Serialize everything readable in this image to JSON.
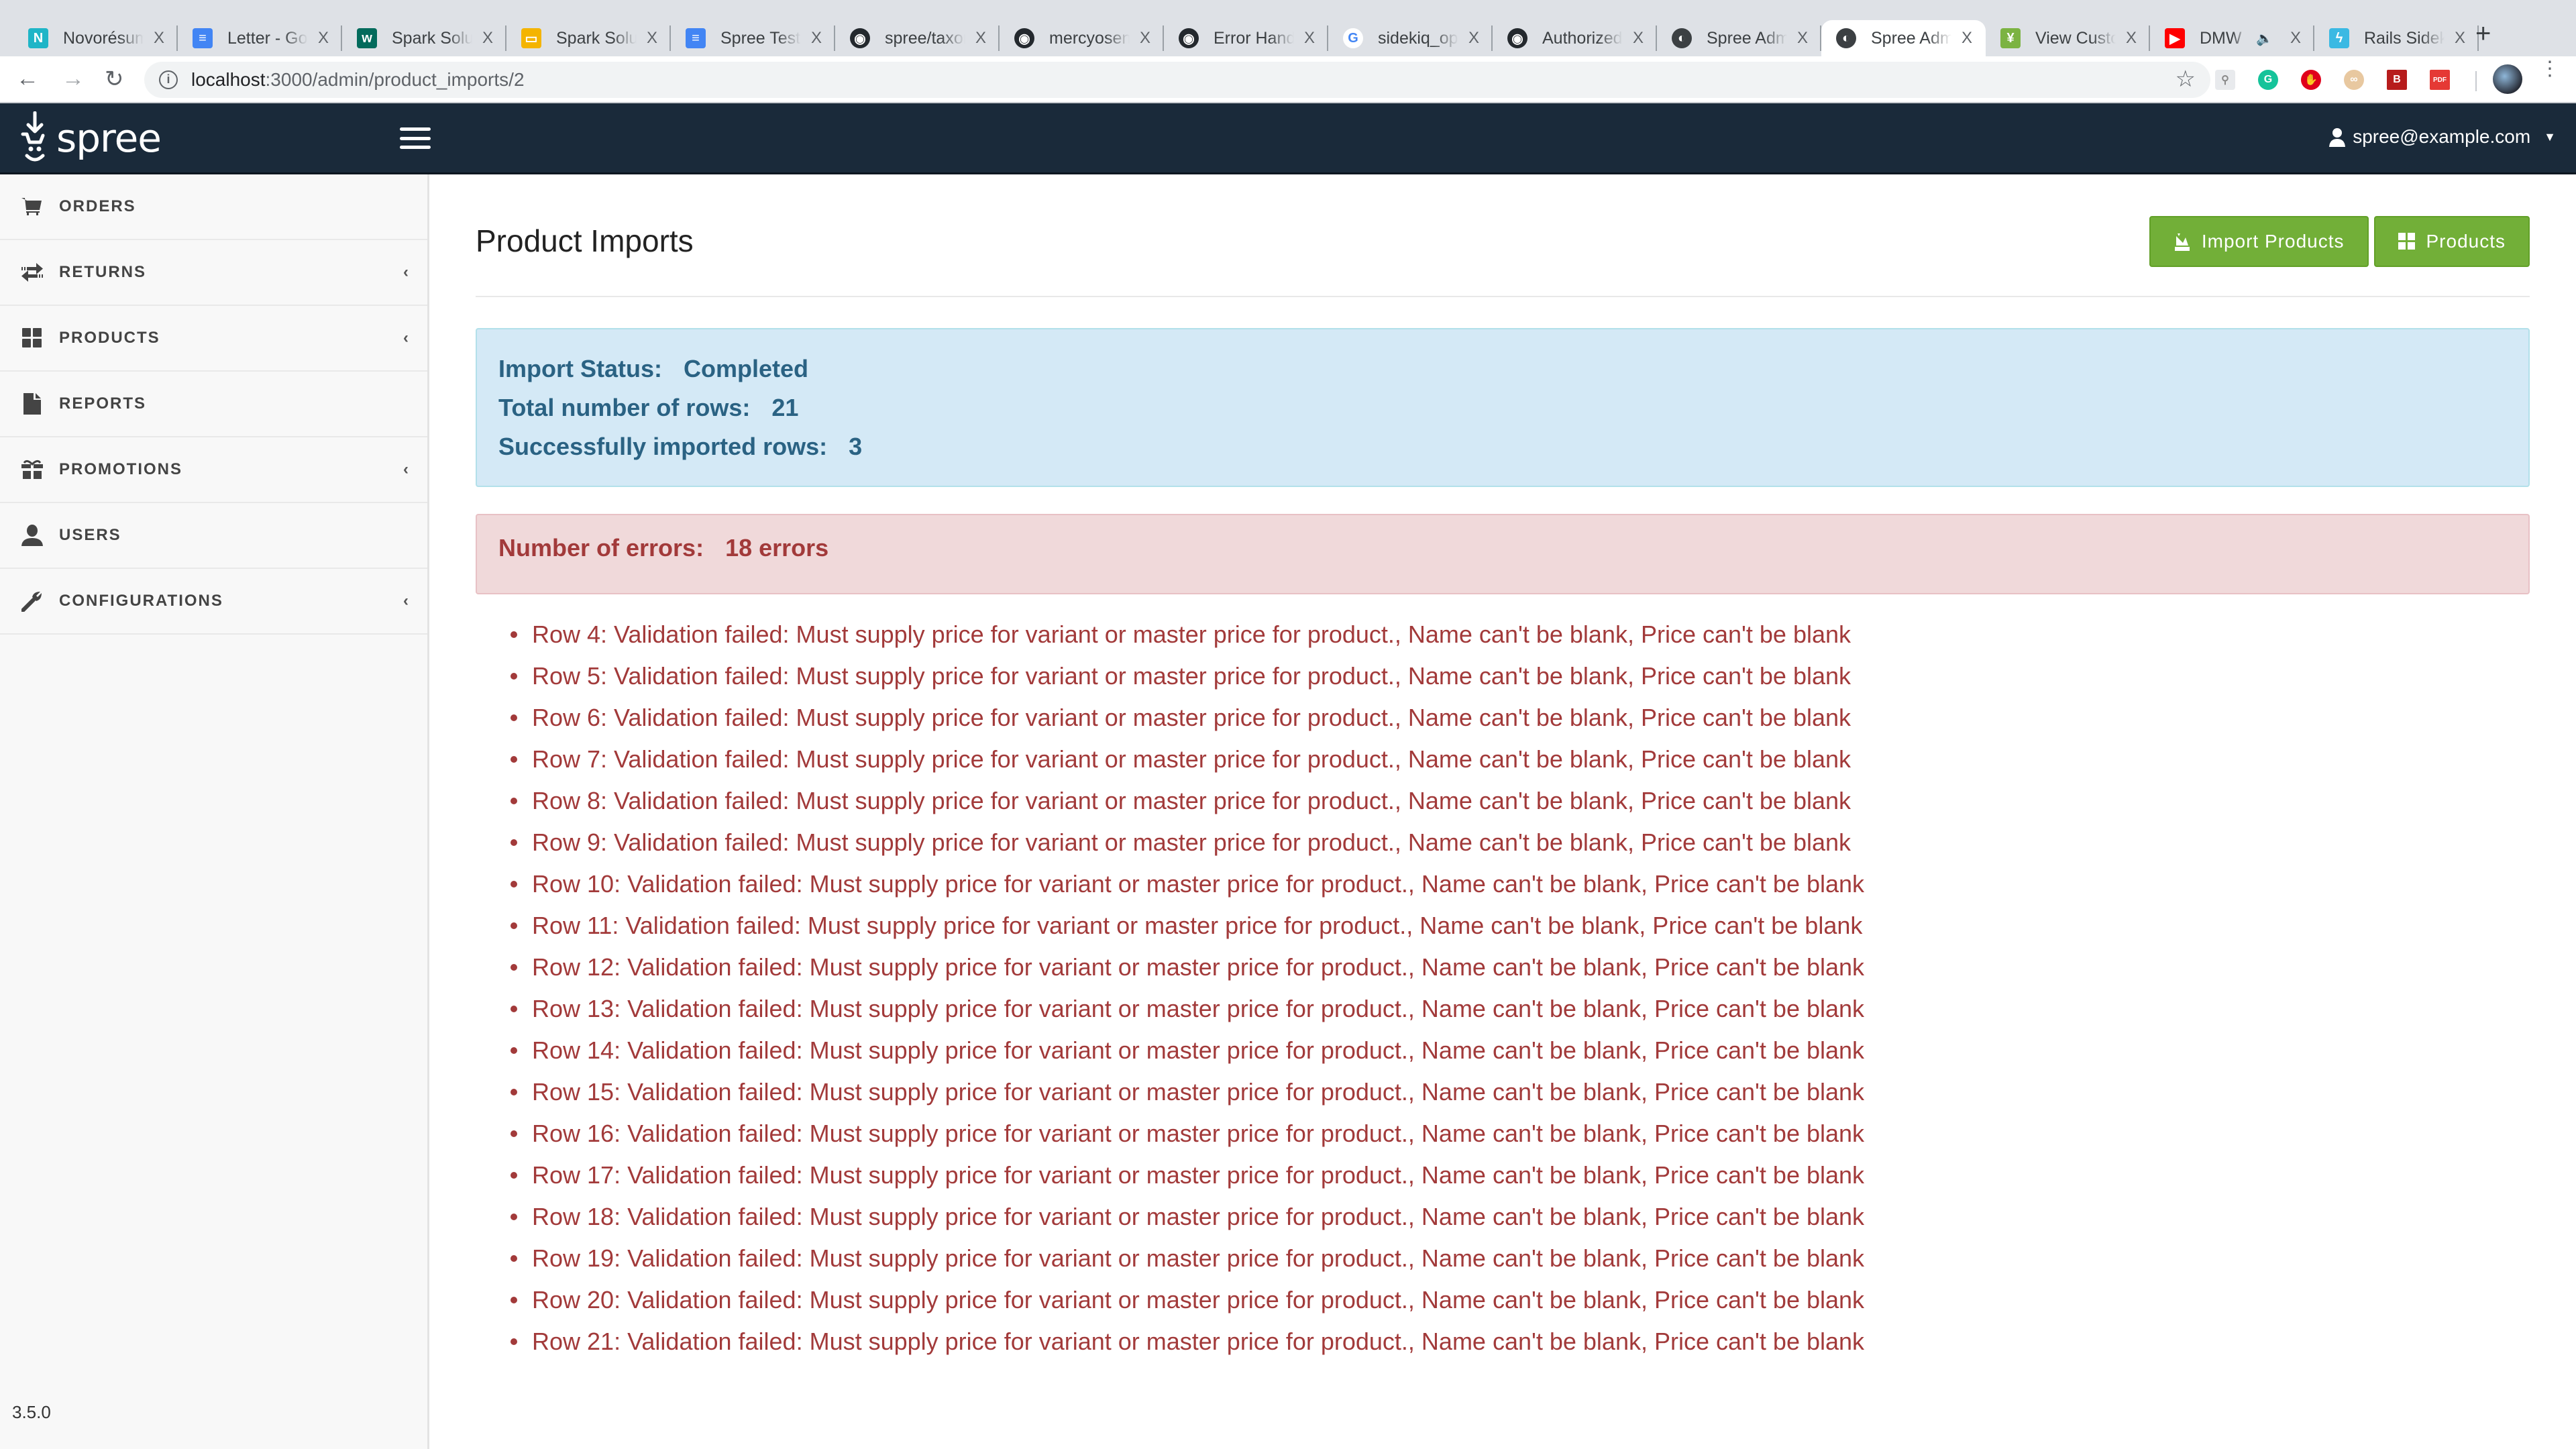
{
  "browser": {
    "tabs": [
      {
        "title": "Novorésumé",
        "icon": "novoresume-icon",
        "color": "#1fb5c7",
        "glyph": "N"
      },
      {
        "title": "Letter - Google Docs",
        "icon": "google-docs-icon",
        "color": "#4285f4",
        "glyph": "≡"
      },
      {
        "title": "Spark Solutions",
        "icon": "workable-icon",
        "color": "#036b5c",
        "glyph": "w"
      },
      {
        "title": "Spark Solutions",
        "icon": "google-slides-icon",
        "color": "#f4b400",
        "glyph": "▭"
      },
      {
        "title": "Spree Test",
        "icon": "google-docs-icon",
        "color": "#4285f4",
        "glyph": "≡"
      },
      {
        "title": "spree/taxons",
        "icon": "github-icon",
        "color": "#24292e",
        "glyph": "◉"
      },
      {
        "title": "mercyoseni",
        "icon": "github-icon",
        "color": "#24292e",
        "glyph": "◉"
      },
      {
        "title": "Error Handling",
        "icon": "github-icon",
        "color": "#24292e",
        "glyph": "◉"
      },
      {
        "title": "sidekiq_options",
        "icon": "google-icon",
        "color": "#ffffff",
        "glyph": "G"
      },
      {
        "title": "Authorized",
        "icon": "github-icon",
        "color": "#24292e",
        "glyph": "◉"
      },
      {
        "title": "Spree Admin",
        "icon": "globe-icon",
        "color": "#3c4043",
        "glyph": "◐"
      },
      {
        "title": "Spree Admin",
        "icon": "globe-icon",
        "color": "#3c4043",
        "glyph": "◐",
        "active": true
      },
      {
        "title": "View Customer",
        "icon": "view-custom-icon",
        "color": "#7cb342",
        "glyph": "¥"
      },
      {
        "title": "DMW",
        "icon": "youtube-icon",
        "color": "#ff0000",
        "glyph": "▶",
        "audio": true
      },
      {
        "title": "Rails Sidekiq",
        "icon": "rails-sidekiq-icon",
        "color": "#3bb9e3",
        "glyph": "ϟ"
      }
    ],
    "new_tab_label": "+",
    "close_glyph": "X",
    "url_host": "localhost",
    "url_rest": ":3000/admin/product_imports/2",
    "extensions": [
      {
        "name": "sitemap-extension-icon",
        "color": "#e8eaed",
        "glyph": "⚲"
      },
      {
        "name": "grammarly-icon",
        "color": "#15c39a",
        "glyph": "G"
      },
      {
        "name": "adblock-icon",
        "color": "#e0001b",
        "glyph": "✋"
      },
      {
        "name": "ext-glasses-icon",
        "color": "#e8c8a0",
        "glyph": "∞"
      },
      {
        "name": "bitdefender-icon",
        "color": "#b71c1c",
        "glyph": "B"
      },
      {
        "name": "pdfjs-icon",
        "color": "#e53935",
        "glyph": "PDF"
      }
    ]
  },
  "navbar": {
    "brand": "spree",
    "user_email": "spree@example.com"
  },
  "sidebar": {
    "items": [
      {
        "label": "ORDERS",
        "icon": "cart-icon",
        "glyph": "🛒",
        "submenu": false
      },
      {
        "label": "RETURNS",
        "icon": "exchange-icon",
        "glyph": "⇄",
        "submenu": true
      },
      {
        "label": "PRODUCTS",
        "icon": "grid-icon",
        "glyph": "▦",
        "submenu": true
      },
      {
        "label": "REPORTS",
        "icon": "file-icon",
        "glyph": "▮",
        "submenu": false
      },
      {
        "label": "PROMOTIONS",
        "icon": "gift-icon",
        "glyph": "🎁",
        "submenu": true
      },
      {
        "label": "USERS",
        "icon": "user-icon",
        "glyph": "👤",
        "submenu": false
      },
      {
        "label": "CONFIGURATIONS",
        "icon": "wrench-icon",
        "glyph": "🔧",
        "submenu": true
      }
    ],
    "chevron": "‹",
    "version": "3.5.0"
  },
  "page": {
    "title": "Product Imports",
    "buttons": {
      "import_products": "Import Products",
      "products": "Products"
    },
    "summary": {
      "status_label": "Import Status:",
      "status_value": "Completed",
      "total_label": "Total number of rows:",
      "total_value": "21",
      "success_label": "Successfully imported rows:",
      "success_value": "3"
    },
    "errors_summary": {
      "label": "Number of errors:",
      "value": "18 errors"
    },
    "errors": [
      "Row 4: Validation failed: Must supply price for variant or master price for product., Name can't be blank, Price can't be blank",
      "Row 5: Validation failed: Must supply price for variant or master price for product., Name can't be blank, Price can't be blank",
      "Row 6: Validation failed: Must supply price for variant or master price for product., Name can't be blank, Price can't be blank",
      "Row 7: Validation failed: Must supply price for variant or master price for product., Name can't be blank, Price can't be blank",
      "Row 8: Validation failed: Must supply price for variant or master price for product., Name can't be blank, Price can't be blank",
      "Row 9: Validation failed: Must supply price for variant or master price for product., Name can't be blank, Price can't be blank",
      "Row 10: Validation failed: Must supply price for variant or master price for product., Name can't be blank, Price can't be blank",
      "Row 11: Validation failed: Must supply price for variant or master price for product., Name can't be blank, Price can't be blank",
      "Row 12: Validation failed: Must supply price for variant or master price for product., Name can't be blank, Price can't be blank",
      "Row 13: Validation failed: Must supply price for variant or master price for product., Name can't be blank, Price can't be blank",
      "Row 14: Validation failed: Must supply price for variant or master price for product., Name can't be blank, Price can't be blank",
      "Row 15: Validation failed: Must supply price for variant or master price for product., Name can't be blank, Price can't be blank",
      "Row 16: Validation failed: Must supply price for variant or master price for product., Name can't be blank, Price can't be blank",
      "Row 17: Validation failed: Must supply price for variant or master price for product., Name can't be blank, Price can't be blank",
      "Row 18: Validation failed: Must supply price for variant or master price for product., Name can't be blank, Price can't be blank",
      "Row 19: Validation failed: Must supply price for variant or master price for product., Name can't be blank, Price can't be blank",
      "Row 20: Validation failed: Must supply price for variant or master price for product., Name can't be blank, Price can't be blank",
      "Row 21: Validation failed: Must supply price for variant or master price for product., Name can't be blank, Price can't be blank"
    ]
  },
  "colors": {
    "navbar_bg": "#1a2a3a",
    "button_green": "#72af38",
    "info_bg": "#d4e9f6",
    "info_text": "#2a6283",
    "danger_bg": "#f0d9da",
    "danger_text": "#a23a3a"
  }
}
